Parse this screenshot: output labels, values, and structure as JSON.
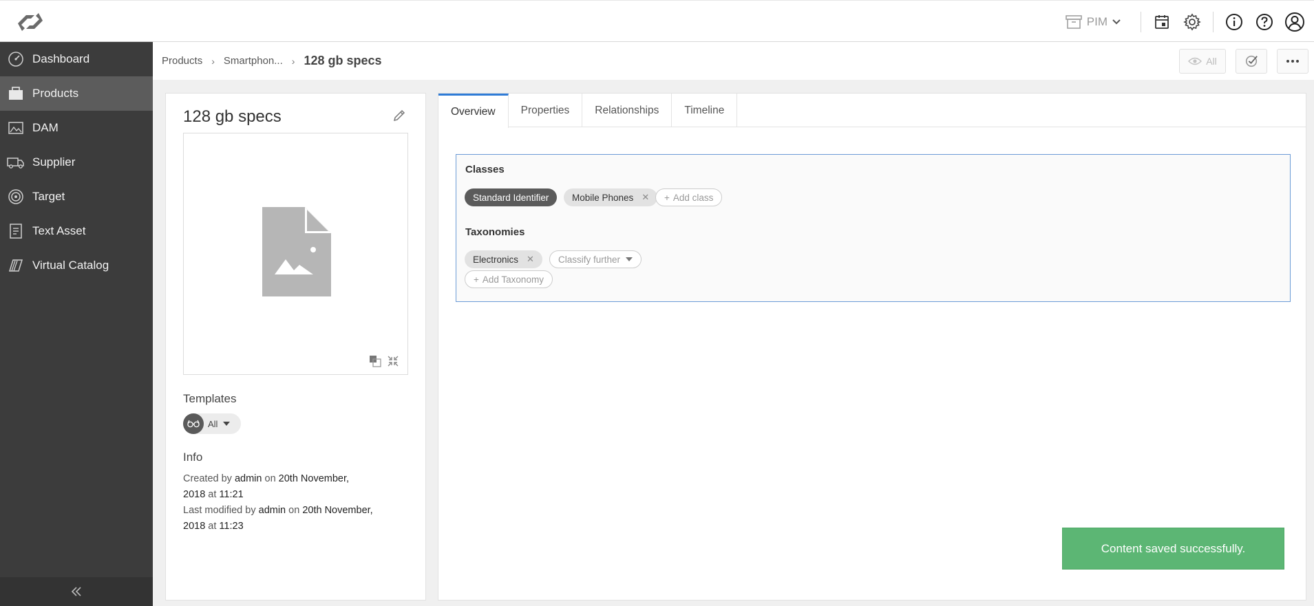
{
  "topbar": {
    "module": "PIM",
    "icons": [
      "logo-icon",
      "archive-box-icon",
      "chevron-down-icon",
      "calendar-box-icon",
      "gear-icon",
      "info-icon",
      "help-icon",
      "user-icon"
    ]
  },
  "sidebar": {
    "items": [
      {
        "label": "Dashboard",
        "icon": "dashboard-icon"
      },
      {
        "label": "Products",
        "icon": "products-icon"
      },
      {
        "label": "DAM",
        "icon": "image-icon"
      },
      {
        "label": "Supplier",
        "icon": "truck-icon"
      },
      {
        "label": "Target",
        "icon": "target-icon"
      },
      {
        "label": "Text Asset",
        "icon": "document-icon"
      },
      {
        "label": "Virtual Catalog",
        "icon": "catalog-icon"
      }
    ],
    "active": "Products"
  },
  "breadcrumb": {
    "items": [
      "Products",
      "Smartphon..."
    ],
    "current": "128 gb specs",
    "view_filter": "All"
  },
  "product": {
    "title": "128 gb specs",
    "templates_label": "Templates",
    "template_value": "All",
    "info_label": "Info",
    "info": {
      "created_prefix": "Created by",
      "created_user": "admin",
      "created_on": "on",
      "created_date": "20th November,",
      "created_year": "2018",
      "created_at": "at",
      "created_time": "11:21",
      "modified_prefix": "Last modified by",
      "modified_user": "admin",
      "modified_on": "on",
      "modified_date": "20th November,",
      "modified_year": "2018",
      "modified_at": "at",
      "modified_time": "11:23"
    }
  },
  "tabs": [
    "Overview",
    "Properties",
    "Relationships",
    "Timeline"
  ],
  "active_tab": "Overview",
  "classes": {
    "label": "Classes",
    "items": [
      {
        "label": "Standard Identifier",
        "style": "dark"
      },
      {
        "label": "Mobile Phones",
        "style": "light",
        "removable": true
      }
    ],
    "add_label": "Add class"
  },
  "taxonomies": {
    "label": "Taxonomies",
    "items": [
      {
        "label": "Electronics",
        "removable": true
      }
    ],
    "classify_label": "Classify further",
    "add_label": "Add Taxonomy"
  },
  "toast": {
    "message": "Content saved successfully.",
    "color": "#5cb674"
  },
  "colors": {
    "sidebar_bg": "#3c3c3c",
    "sidebar_active": "#5c5c5c",
    "accent": "#2f7bd6"
  }
}
